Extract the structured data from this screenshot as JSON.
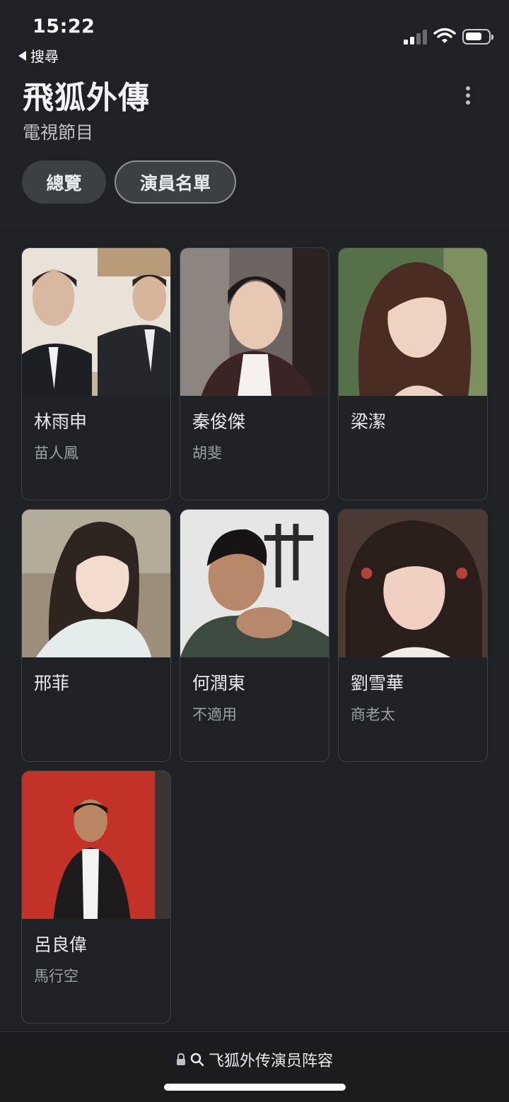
{
  "status_bar": {
    "time": "15:22",
    "back_label": "搜尋"
  },
  "header": {
    "title": "飛狐外傳",
    "subtitle": "電視節目"
  },
  "tabs": [
    {
      "label": "總覽"
    },
    {
      "label": "演員名單"
    }
  ],
  "cast": [
    {
      "name": "林雨申",
      "role": "苗人鳳"
    },
    {
      "name": "秦俊傑",
      "role": "胡斐"
    },
    {
      "name": "梁潔",
      "role": ""
    },
    {
      "name": "邢菲",
      "role": ""
    },
    {
      "name": "何潤東",
      "role": "不適用"
    },
    {
      "name": "劉雪華",
      "role": "商老太"
    },
    {
      "name": "呂良偉",
      "role": "馬行空"
    }
  ],
  "address_bar": {
    "text": "飞狐外传演员阵容"
  },
  "icons": [
    "back-triangle-icon",
    "signal-icon",
    "wifi-icon",
    "battery-icon",
    "more-vert-icon",
    "lock-icon",
    "search-icon"
  ]
}
